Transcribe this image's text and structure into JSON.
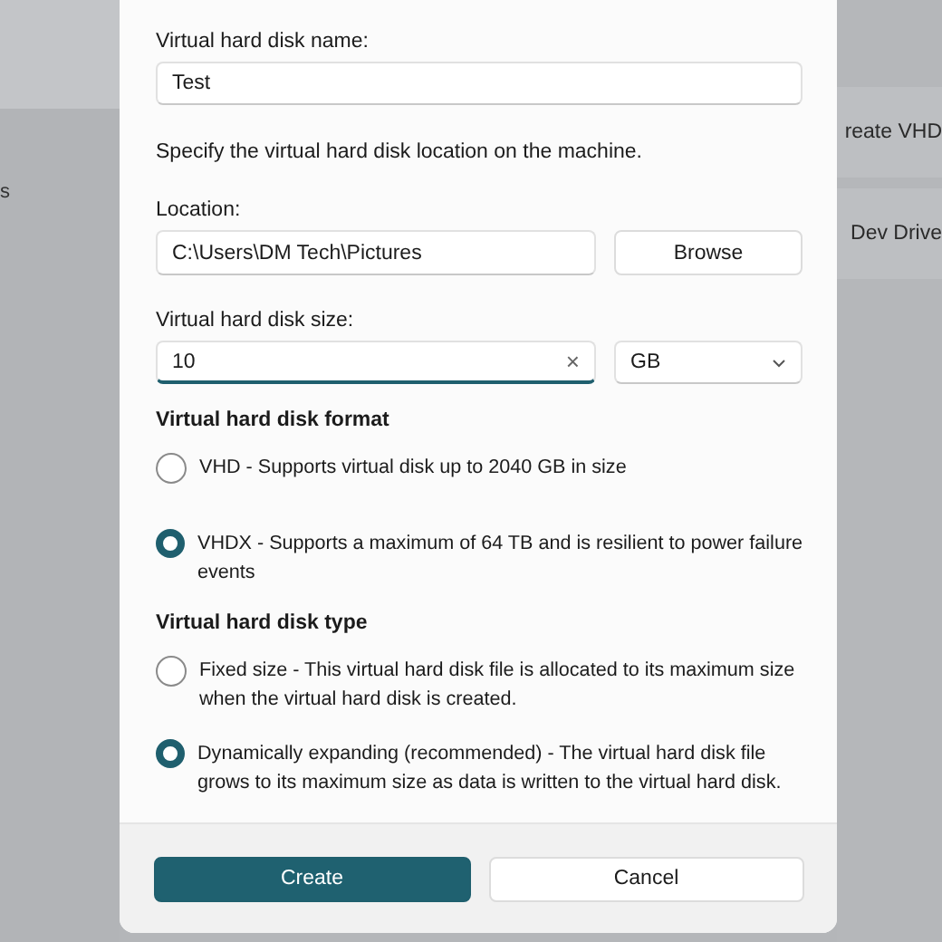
{
  "background": {
    "left_text": "s",
    "right_items": [
      "reate VHD",
      "Dev Drive"
    ]
  },
  "dialog": {
    "name_label": "Virtual hard disk name:",
    "name_value": "Test",
    "location_hint": "Specify the virtual hard disk location on the machine.",
    "location_label": "Location:",
    "location_value": "C:\\Users\\DM Tech\\Pictures",
    "browse_button": "Browse",
    "size_label": "Virtual hard disk size:",
    "size_value": "10",
    "clear_glyph": "×",
    "unit": "GB",
    "groups": [
      {
        "title": "Virtual hard disk format",
        "options": [
          {
            "label": "VHD - Supports virtual disk up to 2040 GB in size",
            "selected": false
          },
          {
            "label": "VHDX - Supports a maximum of 64 TB and is resilient to power failure events",
            "selected": true
          }
        ]
      },
      {
        "title": "Virtual hard disk type",
        "options": [
          {
            "label": "Fixed size - This virtual hard disk file is allocated to its maximum size when the virtual hard disk is created.",
            "selected": false
          },
          {
            "label": "Dynamically expanding (recommended) - The virtual hard disk file grows to its maximum size as data is written to the virtual hard disk.",
            "selected": true
          }
        ]
      }
    ],
    "buttons": [
      {
        "label": "Create",
        "kind": "primary"
      },
      {
        "label": "Cancel",
        "kind": "secondary"
      }
    ]
  }
}
